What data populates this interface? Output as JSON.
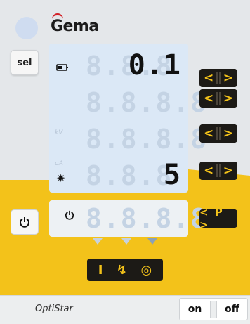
{
  "brand": {
    "logo_text": "Gema",
    "accent_red": "#d21f26",
    "accent_yellow": "#f3c21a"
  },
  "controls": {
    "sel_label": "sel"
  },
  "display": {
    "rows": [
      {
        "label": "",
        "ghost": "8.8.8",
        "value": "0.1"
      },
      {
        "label": "",
        "ghost": "8.8.8.8",
        "value": ""
      },
      {
        "label": "kV",
        "ghost": "8.8.8.8",
        "value": ""
      },
      {
        "label": "µA",
        "ghost": "8.8.8",
        "value": "5"
      }
    ],
    "lower_row": {
      "ghost": "8.8.8.8",
      "value": ""
    }
  },
  "arrows": {
    "left": "<",
    "right": ">"
  },
  "program_button": "< P >",
  "mode_bar": [
    "I",
    "↯",
    "◎"
  ],
  "footer": {
    "app_name": "OptiStar",
    "on_label": "on",
    "off_label": "off"
  }
}
